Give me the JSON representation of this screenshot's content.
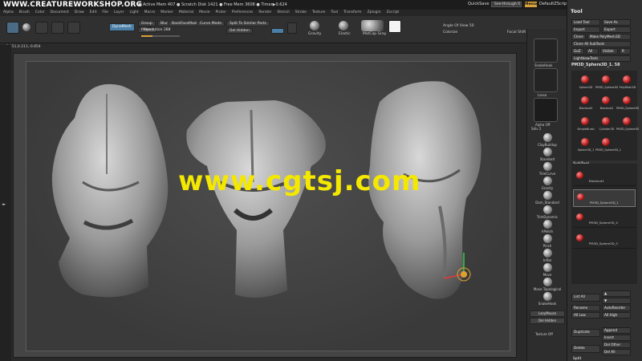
{
  "top_bar": {
    "site_logo": "WWW.CREATUREWORKSHOP.ORG",
    "stats": "● Active Mem 407  ● Scratch Disk 1421  ● Free Mem 3608  ● Timer▶0.624",
    "quicksave": "QuickSave",
    "see_through": "See-through 0",
    "menus": "Menus",
    "default_zscript": "DefaultZScript"
  },
  "menubar": {
    "items": [
      "Alpha",
      "Brush",
      "Color",
      "Document",
      "Draw",
      "Edit",
      "File",
      "Layer",
      "Light",
      "Macro",
      "Marker",
      "Material",
      "Movie",
      "Picker",
      "Preferences",
      "Render",
      "Stencil",
      "Stroke",
      "Texture",
      "Tool",
      "Transform",
      "Zplugin",
      "Zscript"
    ]
  },
  "toolbar": {
    "dynamesh": "DynaMesh",
    "group": "Group",
    "project": "Project",
    "blur": "Blur 2",
    "backface_mask": "BackFaceMask",
    "curve_mode": "Curve Mode",
    "split_to_similar": "Split To Similar Parts",
    "del_hidden": "Del Hidden",
    "resolution": "Resolution 288",
    "gravity": "Gravity",
    "elastic": "Elastic",
    "matcap_gray": "MatCap Gray",
    "angle_of_view": "Angle Of View 50",
    "colorize": "Colorize",
    "focal_shift": "Focal Shift 0",
    "resolution_fill": 0.29
  },
  "coords": "-0.451,0.211,-0.854",
  "watermark": "www.cgtsj.com",
  "brushes": {
    "scroll_label": "Sdiv 2",
    "items": [
      "ClayBuildup",
      "Standard",
      "TrimCurve",
      "Gravity",
      "Dam_Standard",
      "TrimDynamic",
      "hPolish",
      "Pinch",
      "Inflat",
      "Move",
      "Move Topological",
      "SnakeHook"
    ],
    "lazymouse": "LazyMouse",
    "del_hidden": "Del Hidden",
    "mat_caption_1": "SnakeHook",
    "mat_caption_2": "Lasso",
    "mat_caption_3": "Alpha Off",
    "texture_off": "Texture Off"
  },
  "tool_panel": {
    "title": "Tool",
    "load_tool": "Load Tool",
    "save_as": "Save As",
    "import": "Import",
    "export": "Export",
    "clone": "Clone",
    "make_polymesh": "Make PolyMesh3D",
    "clone_all_subtools": "Clone All SubTools",
    "goz": "GoZ",
    "all": "All",
    "visible": "Visible",
    "r": "R",
    "lightbox_tools": "Lightbox▸Tools",
    "current_tool": "PM3D_Sphere3D_1. 58",
    "thumbs": [
      "Sphere3D",
      "PM3D_Sphere3D",
      "PolyMesh3D",
      "Blockout2",
      "Blockout1",
      "PM3D_Sphere3D",
      "SimpleBrush",
      "Cylinder3D",
      "PM3D_Sphere3D",
      "Sphere3D_1",
      "PM3D_Sphere3D_1"
    ],
    "subtool_header": "SubTool",
    "subtools": [
      "Blockout1",
      "PM3D_Sphere3D_1",
      "PM3D_Sphere3D_4",
      "PM3D_Sphere3D_3"
    ],
    "list_all": "List All",
    "rename": "Rename",
    "auto_reorder": "AutoReorder",
    "all_low": "All Low",
    "all_high": "All High",
    "duplicate": "Duplicate",
    "append": "Append",
    "insert": "Insert",
    "delete": "Delete",
    "del_other": "Del Other",
    "del_all": "Del All",
    "split": "Split"
  },
  "colors": {
    "accent": "#d9a13c",
    "watermark": "#f4e800",
    "selected_tool": "#c62828"
  }
}
